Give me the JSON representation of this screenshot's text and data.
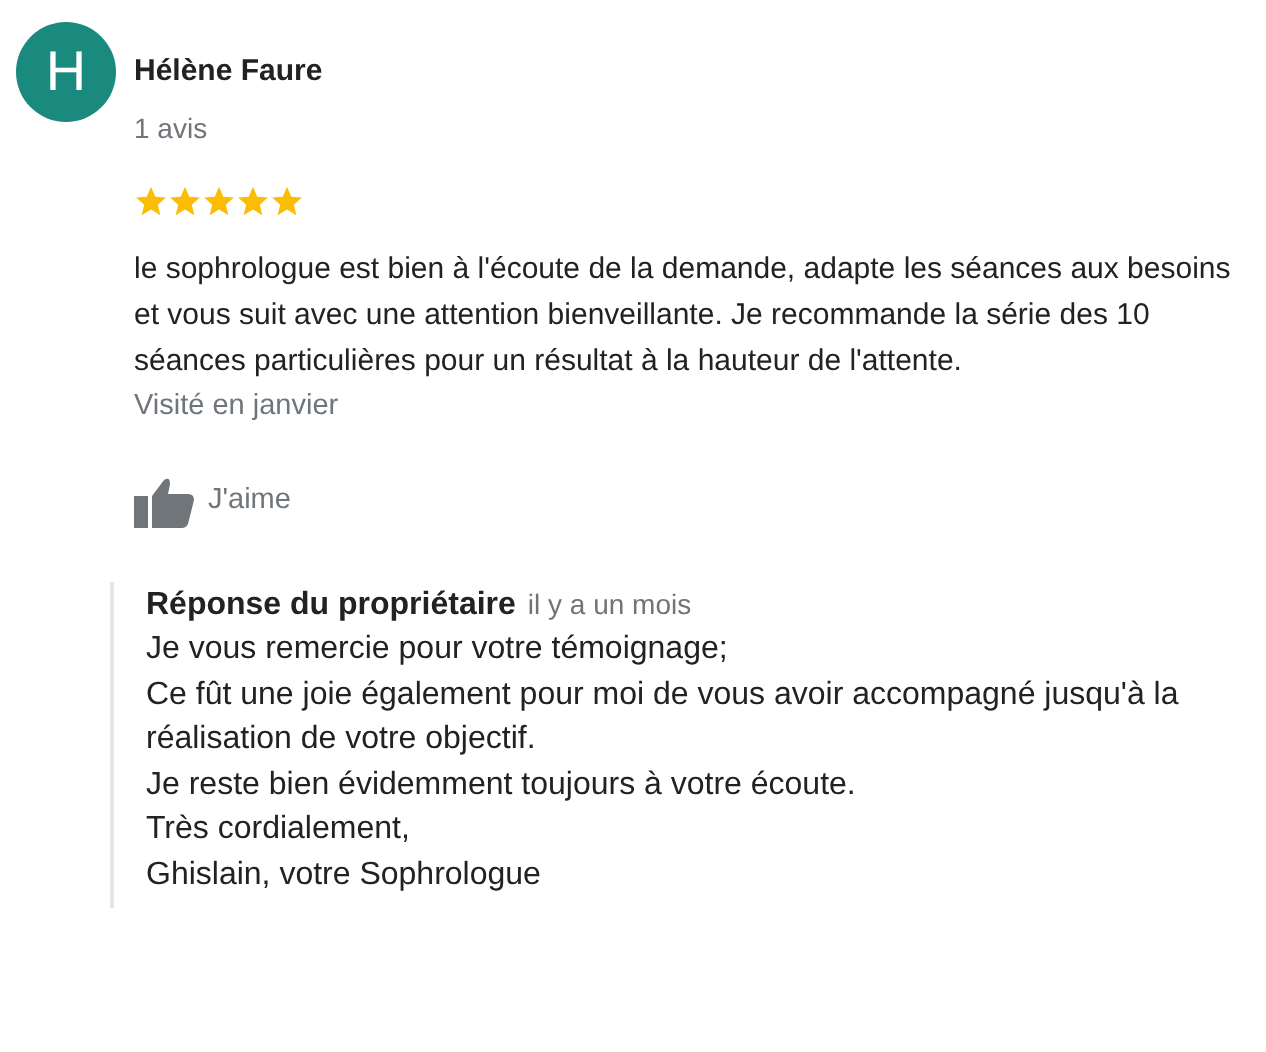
{
  "review": {
    "avatar_letter": "H",
    "author": "Hélène Faure",
    "count": "1 avis",
    "stars": 5,
    "text": "le sophrologue est bien à l'écoute de la demande, adapte les séances aux besoins et vous suit avec une attention bienveillante. Je recommande la série des 10 séances particulières pour un résultat à la hauteur de l'attente.",
    "visited": "Visité en janvier",
    "like_label": "J'aime"
  },
  "owner_response": {
    "title": "Réponse du propriétaire",
    "time": "il y a un mois",
    "lines": [
      "Je vous remercie pour votre témoignage;",
      "Ce fût une joie également pour moi de vous avoir accompagné jusqu'à la réalisation de votre objectif.",
      "Je reste bien évidemment toujours à votre écoute.",
      "Très cordialement,",
      "Ghislain, votre Sophrologue"
    ]
  }
}
